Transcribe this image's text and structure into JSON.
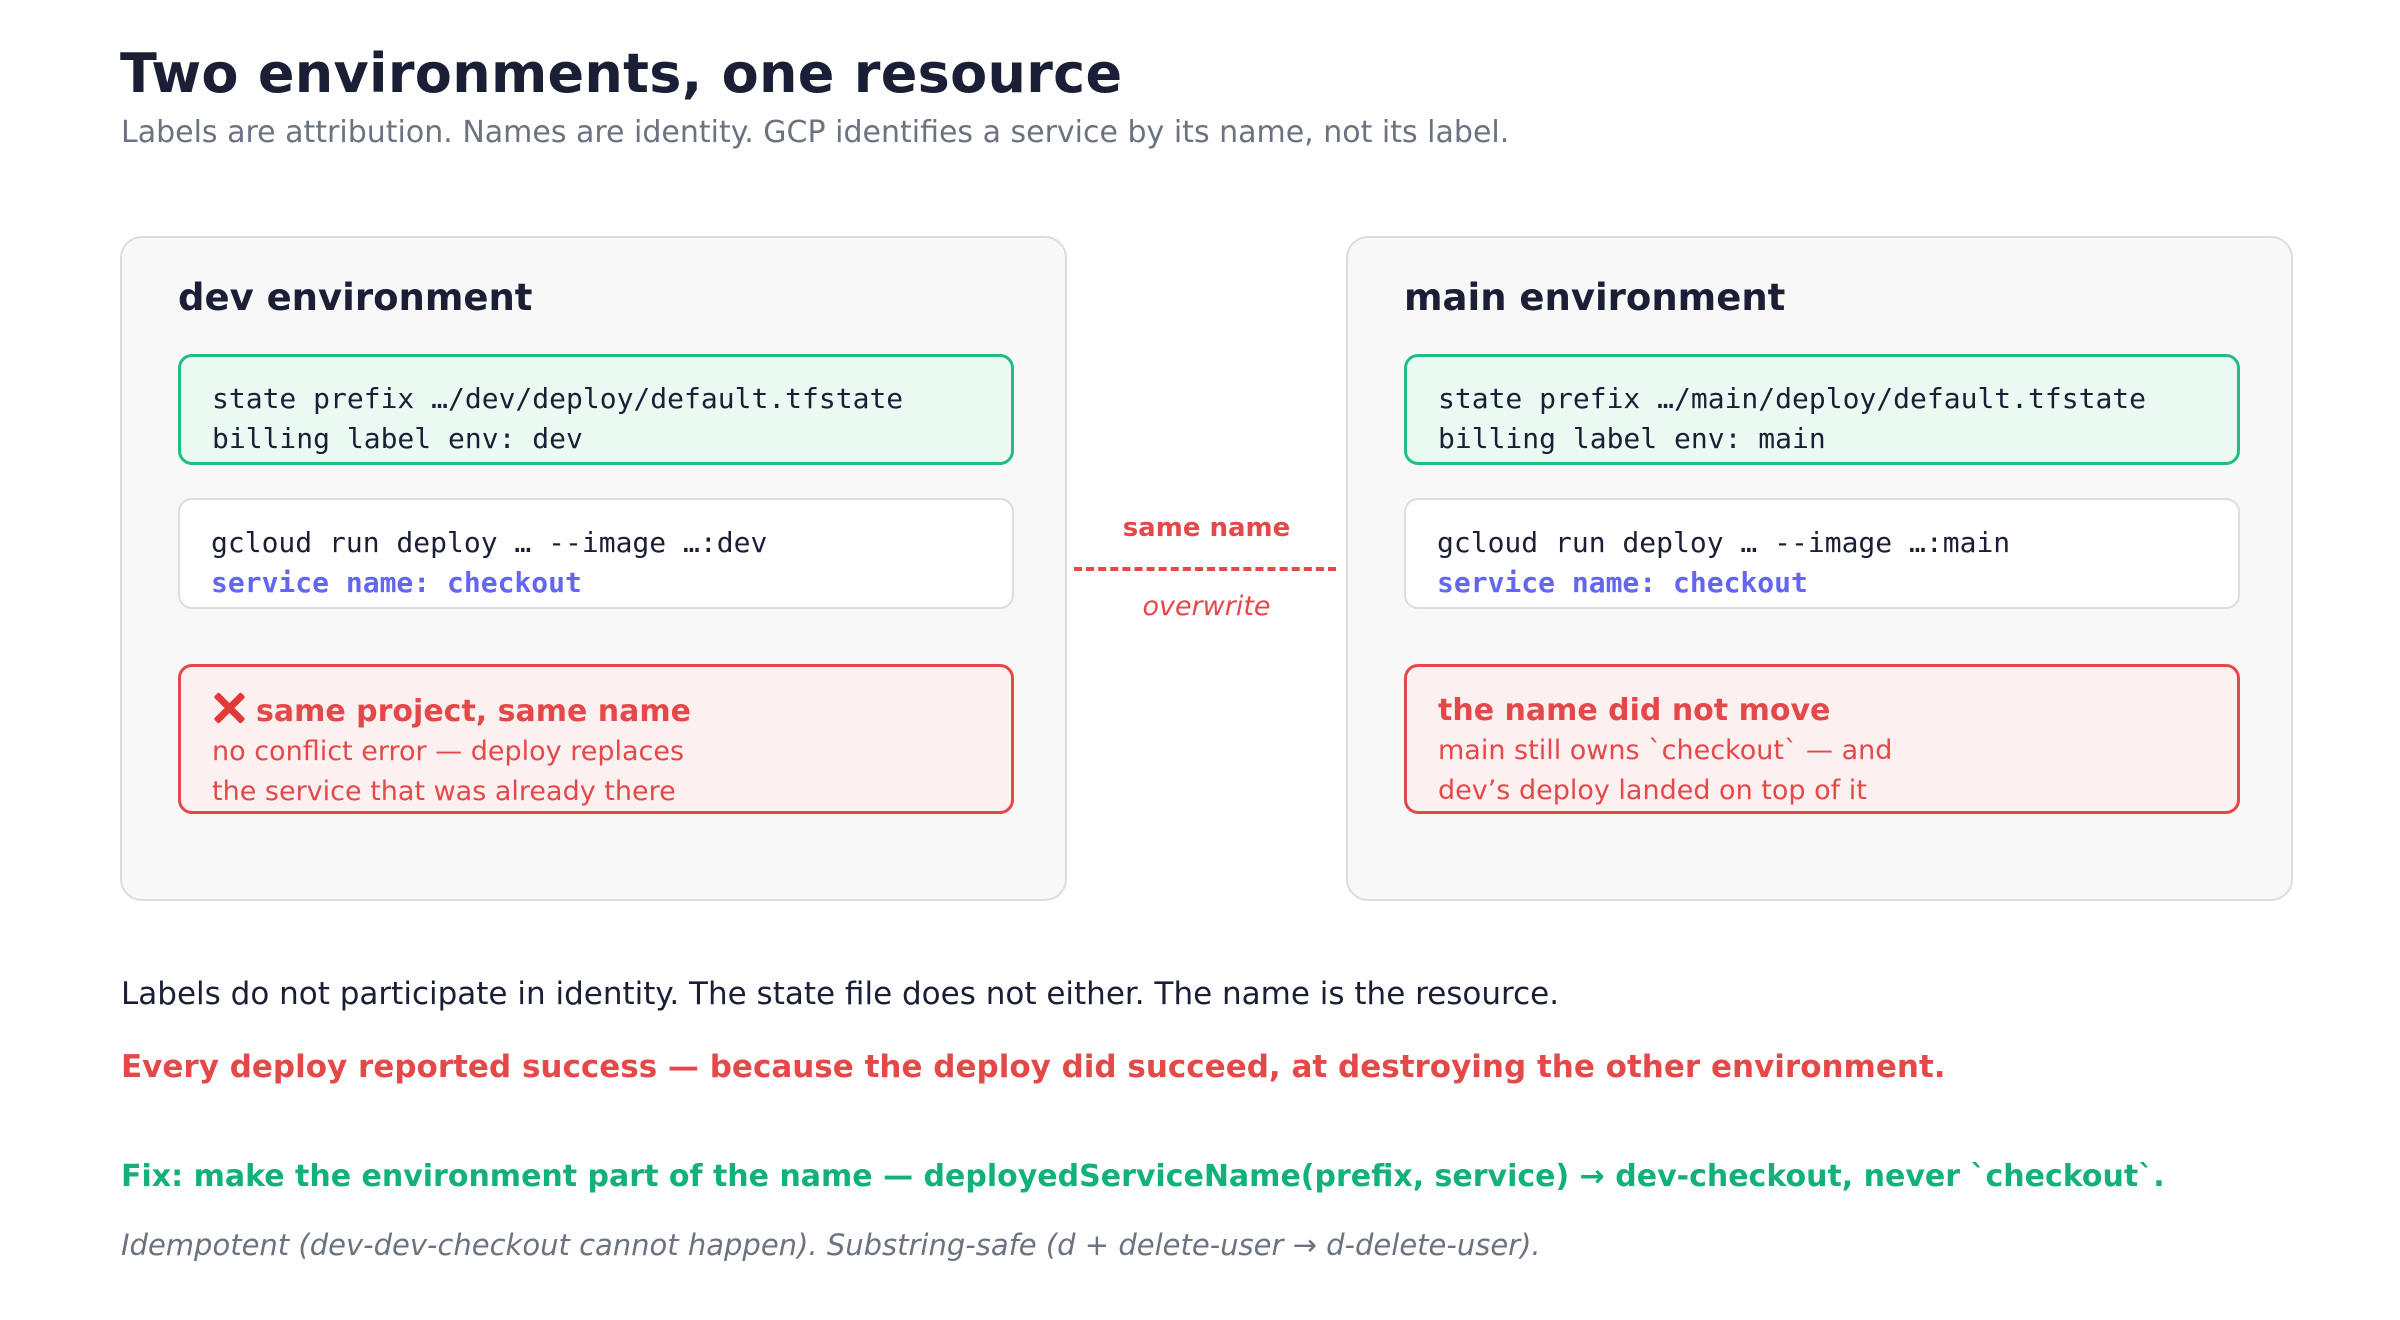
{
  "header": {
    "title": "Two environments, one resource",
    "subtitle": "Labels are attribution. Names are identity. GCP identifies a service by its name, not its label."
  },
  "dev": {
    "title": "dev environment",
    "state_line1": "state prefix …/dev/deploy/default.tfstate",
    "state_line2": "billing label env: dev",
    "cmd_line1": "gcloud run deploy … --image …:dev",
    "cmd_line2": "service name: checkout",
    "warn_icon": "cross-mark-icon",
    "warn_title": "same project, same name",
    "warn_line1": "no conflict error — deploy replaces",
    "warn_line2": "the service that was already there"
  },
  "main": {
    "title": "main environment",
    "state_line1": "state prefix …/main/deploy/default.tfstate",
    "state_line2": "billing label env: main",
    "cmd_line1": "gcloud run deploy … --image …:main",
    "cmd_line2": "service name: checkout",
    "warn_title": "the name did not move",
    "warn_line1": "main still owns `checkout` — and",
    "warn_line2": "dev’s deploy landed on top of it"
  },
  "connector": {
    "label": "same name",
    "sublabel": "overwrite"
  },
  "footer": {
    "note": "Labels do not participate in identity. The state file does not either. The name is the resource.",
    "alert": "Every deploy reported success — because the deploy did succeed, at destroying the other environment.",
    "fix": "Fix: make the environment part of the name — deployedServiceName(prefix, service) → dev-checkout, never `checkout`.",
    "footnote": "Idempotent (dev-dev-checkout cannot happen). Substring-safe (d + delete-user → d-delete-user)."
  },
  "colors": {
    "ok_green": "#1fbf84",
    "danger_red": "#e54848",
    "accent_indigo": "#6366f1",
    "fix_green": "#12b07a"
  }
}
